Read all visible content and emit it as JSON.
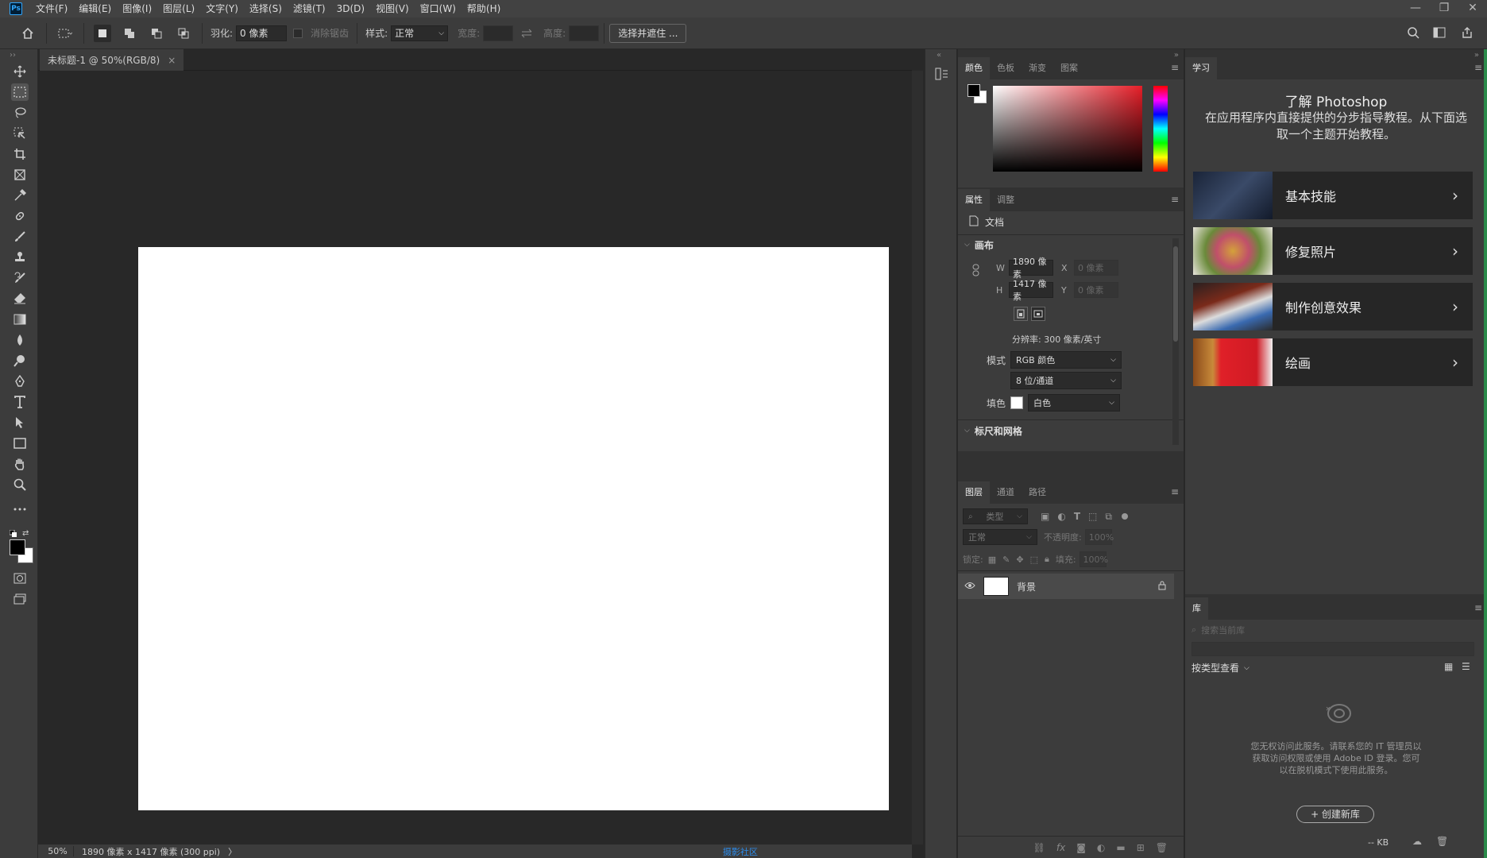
{
  "app": {
    "logo": "Ps"
  },
  "menubar": {
    "items": [
      "文件(F)",
      "编辑(E)",
      "图像(I)",
      "图层(L)",
      "文字(Y)",
      "选择(S)",
      "滤镜(T)",
      "3D(D)",
      "视图(V)",
      "窗口(W)",
      "帮助(H)"
    ]
  },
  "window_controls": {
    "minimize": "—",
    "restore": "❐",
    "close": "✕"
  },
  "options": {
    "feather_label": "羽化:",
    "feather_value": "0 像素",
    "antialias_label": "消除锯齿",
    "style_label": "样式:",
    "style_value": "正常",
    "width_label": "宽度:",
    "height_label": "高度:",
    "select_mask_button": "选择并遮住 ..."
  },
  "document": {
    "tab_title": "未标题-1 @ 50%(RGB/8)",
    "close": "×"
  },
  "status": {
    "zoom": "50%",
    "info": "1890 像素 x 1417 像素 (300 ppi)",
    "arrow": "〉",
    "community_link": "摄影社区"
  },
  "color_panel": {
    "tabs": [
      "颜色",
      "色板",
      "渐变",
      "图案"
    ],
    "foreground": "#000000",
    "background": "#ffffff",
    "hue_base": "#e61e28"
  },
  "properties_panel": {
    "tabs": [
      "属性",
      "调整"
    ],
    "doc_label": "文档",
    "canvas_section": "画布",
    "w_label": "W",
    "w_value": "1890 像素",
    "h_label": "H",
    "h_value": "1417 像素",
    "x_label": "X",
    "x_value": "0 像素",
    "y_label": "Y",
    "y_value": "0 像素",
    "resolution": "分辨率: 300 像素/英寸",
    "mode_label": "模式",
    "mode_value": "RGB 颜色",
    "depth_value": "8 位/通道",
    "fill_label": "填色",
    "fill_value": "白色",
    "rulers_section": "标尺和网格"
  },
  "layers_panel": {
    "tabs": [
      "图层",
      "通道",
      "路径"
    ],
    "filter_placeholder": "类型",
    "blend_mode": "正常",
    "opacity_label": "不透明度:",
    "opacity_value": "100%",
    "lock_label": "锁定:",
    "fill_label": "填充:",
    "fill_value": "100%",
    "layers": [
      {
        "name": "背景"
      }
    ]
  },
  "learn_panel": {
    "tab": "学习",
    "title": "了解 Photoshop",
    "subtitle": "在应用程序内直接提供的分步指导教程。从下面选取一个主题开始教程。",
    "cards": [
      {
        "label": "基本技能"
      },
      {
        "label": "修复照片"
      },
      {
        "label": "制作创意效果"
      },
      {
        "label": "绘画"
      }
    ]
  },
  "library_panel": {
    "tab": "库",
    "search_placeholder": "搜索当前库",
    "view_by": "按类型查看",
    "message": "您无权访问此服务。请联系您的 IT 管理员以获取访问权限或使用 Adobe ID 登录。您可以在脱机模式下使用此服务。",
    "create_button": "+ 创建新库",
    "kb": "-- KB"
  }
}
